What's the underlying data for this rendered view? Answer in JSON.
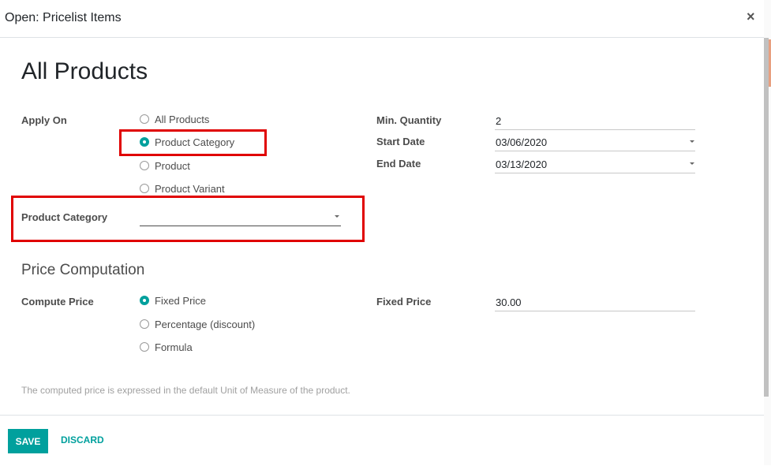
{
  "dialog": {
    "title": "Open: Pricelist Items",
    "close_symbol": "×"
  },
  "form": {
    "title": "All Products",
    "apply_on": {
      "label": "Apply On",
      "options": [
        "All Products",
        "Product Category",
        "Product",
        "Product Variant"
      ],
      "selected": "Product Category"
    },
    "product_category": {
      "label": "Product Category",
      "value": ""
    },
    "min_quantity": {
      "label": "Min. Quantity",
      "value": "2"
    },
    "start_date": {
      "label": "Start Date",
      "value": "03/06/2020"
    },
    "end_date": {
      "label": "End Date",
      "value": "03/13/2020"
    },
    "price_computation": {
      "title": "Price Computation",
      "compute_price": {
        "label": "Compute Price",
        "options": [
          "Fixed Price",
          "Percentage (discount)",
          "Formula"
        ],
        "selected": "Fixed Price"
      },
      "fixed_price": {
        "label": "Fixed Price",
        "value": "30.00"
      }
    },
    "help_text": "The computed price is expressed in the default Unit of Measure of the product."
  },
  "footer": {
    "save_label": "SAVE",
    "discard_label": "DISCARD"
  },
  "colors": {
    "accent": "#00a09d",
    "highlight": "#e00000"
  }
}
